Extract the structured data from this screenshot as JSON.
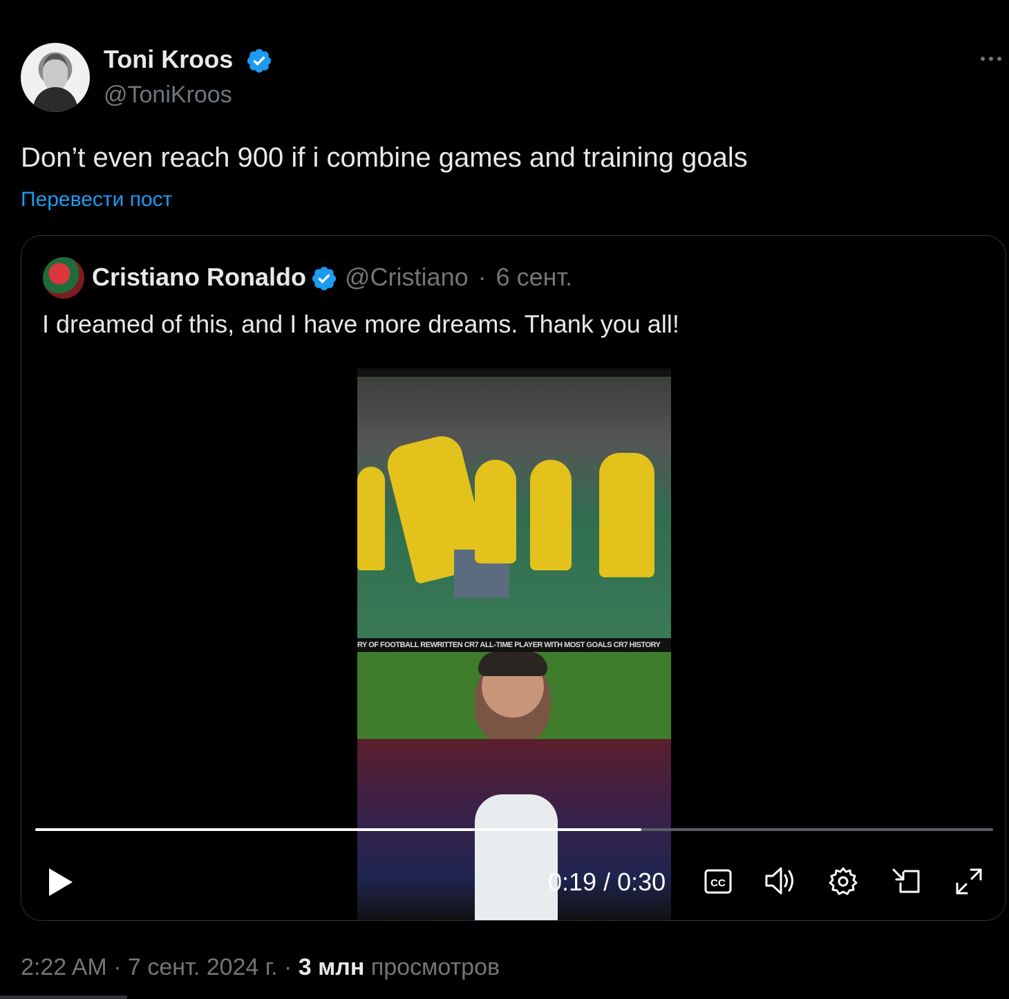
{
  "author": {
    "name": "Toni Kroos",
    "handle": "@ToniKroos"
  },
  "post": {
    "text": "Don’t even reach 900 if i combine games and training goals",
    "translate_label": "Перевести пост",
    "more_icon": "more-horizontal-icon"
  },
  "quoted": {
    "name": "Cristiano Ronaldo",
    "handle": "@Cristiano",
    "separator": "·",
    "date": "6 сент.",
    "text": "I dreamed of this, and I have more dreams. Thank you all!",
    "video": {
      "ticker_text": "RY OF FOOTBALL REWRITTEN  CR7  ALL-TIME PLAYER WITH MOST GOALS  CR7  HISTORY",
      "current_time": "0:19",
      "duration": "0:30",
      "time_display": "0:19 / 0:30",
      "progress": 0.633,
      "controls": [
        "play-icon",
        "captions-icon",
        "volume-icon",
        "settings-icon",
        "dock-icon",
        "fullscreen-icon"
      ]
    }
  },
  "footer": {
    "time": "2:22 AM",
    "date": "7 сент. 2024 г.",
    "views_count": "3 млн",
    "views_label": "просмотров"
  },
  "colors": {
    "background": "#000000",
    "text": "#e7e9ea",
    "muted": "#71767b",
    "link": "#1d9bf0",
    "verified": "#1d9bf0",
    "border": "#2f3336"
  }
}
